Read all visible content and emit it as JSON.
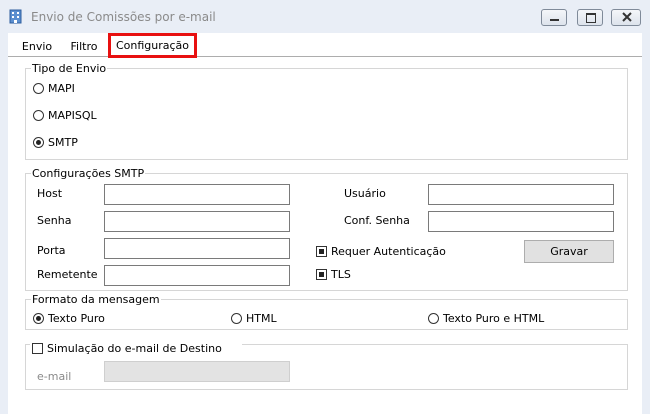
{
  "window": {
    "title": "Envio de Comissões por e-mail",
    "icon": "building-icon",
    "controls": {
      "minimize": "minimize-icon",
      "maximize": "maximize-icon",
      "close": "close-icon"
    }
  },
  "tabs": [
    {
      "label": "Envio",
      "active": false
    },
    {
      "label": "Filtro",
      "active": false
    },
    {
      "label": "Configuração",
      "active": true
    }
  ],
  "tipo_envio": {
    "title": "Tipo de Envio",
    "options": [
      {
        "label": "MAPI",
        "selected": false
      },
      {
        "label": "MAPISQL",
        "selected": false
      },
      {
        "label": "SMTP",
        "selected": true
      }
    ]
  },
  "smtp": {
    "title": "Configurações SMTP",
    "host": {
      "label": "Host",
      "value": ""
    },
    "senha": {
      "label": "Senha",
      "value": ""
    },
    "porta": {
      "label": "Porta",
      "value": ""
    },
    "remetente": {
      "label": "Remetente",
      "value": ""
    },
    "usuario": {
      "label": "Usuário",
      "value": ""
    },
    "conf_senha": {
      "label": "Conf. Senha",
      "value": ""
    },
    "requer_autenticacao": {
      "label": "Requer Autenticação",
      "checked": true
    },
    "tls": {
      "label": "TLS",
      "checked": true
    },
    "gravar_label": "Gravar"
  },
  "formato": {
    "title": "Formato da mensagem",
    "options": [
      {
        "label": "Texto Puro",
        "selected": true
      },
      {
        "label": "HTML",
        "selected": false
      },
      {
        "label": "Texto Puro e HTML",
        "selected": false
      }
    ]
  },
  "simulacao": {
    "label": "Simulação do e-mail de Destino",
    "checked": false,
    "email_label": "e-mail",
    "email_value": ""
  }
}
